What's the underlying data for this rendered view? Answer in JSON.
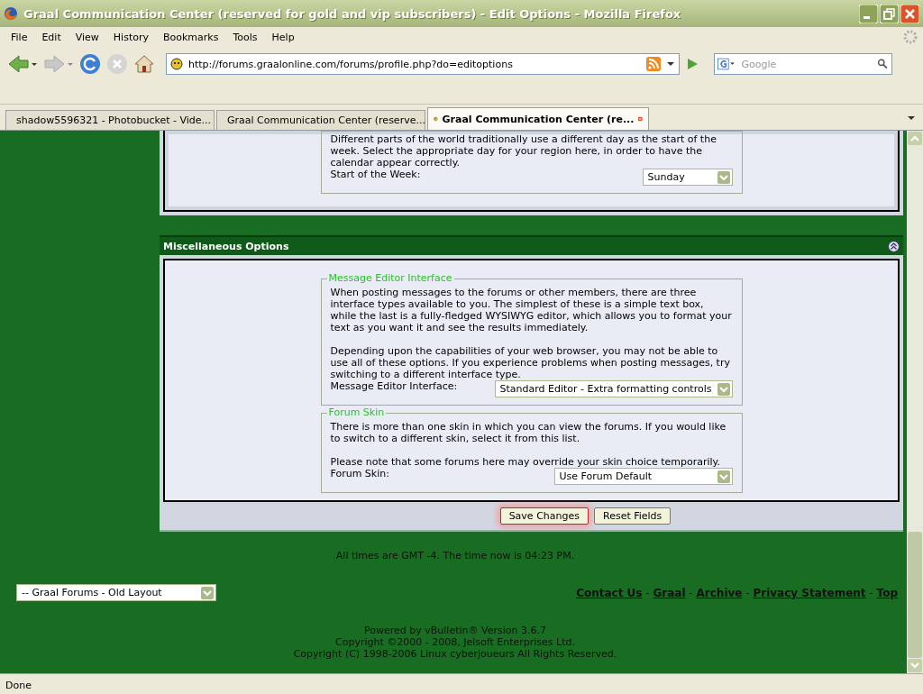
{
  "window": {
    "title": "Graal Communication Center (reserved for gold and vip subscribers) - Edit Options - Mozilla Firefox"
  },
  "menu": [
    "File",
    "Edit",
    "View",
    "History",
    "Bookmarks",
    "Tools",
    "Help"
  ],
  "address": {
    "value": "http://forums.graalonline.com/forums/profile.php?do=editoptions"
  },
  "search": {
    "placeholder": "Google"
  },
  "tabs": [
    {
      "label": "shadow5596321 - Photobucket - Vide...",
      "selected": false,
      "kind": "camera"
    },
    {
      "label": "Graal Communication Center (reserve...",
      "selected": false,
      "kind": "forum"
    },
    {
      "label": "Graal Communication Center (re...",
      "selected": true,
      "kind": "forum"
    }
  ],
  "top_section": {
    "fieldsets": [
      {
        "paragraphs": [
          "Different parts of the world traditionally use a different day as the start of the week. Select the appropriate day for your region here, in order to have the calendar appear correctly."
        ],
        "label": "Start of the Week:",
        "value": "Sunday"
      }
    ]
  },
  "misc_section": {
    "title": "Miscellaneous Options",
    "fieldsets": [
      {
        "legend": "Message Editor Interface",
        "paragraphs": [
          "When posting messages to the forums or other members, there are three interface types available to you. The simplest of these is a simple text box, while the last is a fully-fledged WYSIWYG editor, which allows you to format your text as you want it and see the results immediately.",
          "Depending upon the capabilities of your web browser, you may not be able to use all of these options. If you experience problems when posting messages, try switching to a different interface type."
        ],
        "label": "Message Editor Interface:",
        "value": "Standard Editor - Extra formatting controls"
      },
      {
        "legend": "Forum Skin",
        "paragraphs": [
          "There is more than one skin in which you can view the forums. If you would like to switch to a different skin, select it from this list.",
          "Please note that some forums here may override your skin choice temporarily."
        ],
        "label": "Forum Skin:",
        "value": "Use Forum Default"
      }
    ]
  },
  "buttons": [
    {
      "label": "Save Changes",
      "focused": true
    },
    {
      "label": "Reset Fields",
      "focused": false
    }
  ],
  "footer": {
    "time": "All times are GMT -4. The time now is 04:23 PM.",
    "style_select": "-- Graal Forums - Old Layout",
    "links": [
      "Contact Us",
      "Graal",
      "Archive",
      "Privacy Statement",
      "Top"
    ],
    "separator": "-",
    "copyright": [
      "Powered by vBulletin® Version 3.6.7",
      "Copyright ©2000 - 2008, Jelsoft Enterprises Ltd.",
      "Copyright (C) 1998-2006 Linux cyberjoueurs All Rights Reserved."
    ]
  },
  "status_bar": {
    "text": "Done"
  }
}
